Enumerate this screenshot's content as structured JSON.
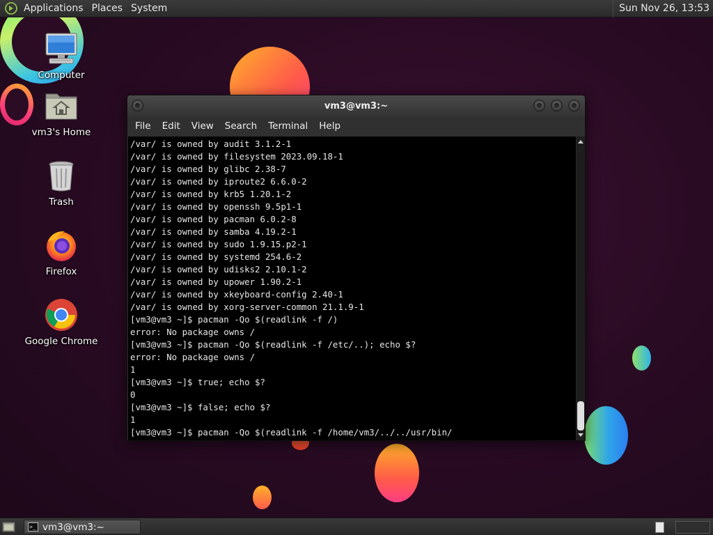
{
  "top_panel": {
    "menus": [
      "Applications",
      "Places",
      "System"
    ],
    "clock": "Sun Nov 26, 13:53"
  },
  "desktop": {
    "icons": [
      {
        "label": "Computer",
        "icon": "computer-icon"
      },
      {
        "label": "vm3's Home",
        "icon": "home-folder-icon"
      },
      {
        "label": "Trash",
        "icon": "trash-icon"
      },
      {
        "label": "Firefox",
        "icon": "firefox-icon"
      },
      {
        "label": "Google Chrome",
        "icon": "chrome-icon"
      }
    ]
  },
  "terminal": {
    "title": "vm3@vm3:~",
    "menus": [
      "File",
      "Edit",
      "View",
      "Search",
      "Terminal",
      "Help"
    ],
    "lines": [
      "/var/ is owned by audit 3.1.2-1",
      "/var/ is owned by filesystem 2023.09.18-1",
      "/var/ is owned by glibc 2.38-7",
      "/var/ is owned by iproute2 6.6.0-2",
      "/var/ is owned by krb5 1.20.1-2",
      "/var/ is owned by openssh 9.5p1-1",
      "/var/ is owned by pacman 6.0.2-8",
      "/var/ is owned by samba 4.19.2-1",
      "/var/ is owned by sudo 1.9.15.p2-1",
      "/var/ is owned by systemd 254.6-2",
      "/var/ is owned by udisks2 2.10.1-2",
      "/var/ is owned by upower 1.90.2-1",
      "/var/ is owned by xkeyboard-config 2.40-1",
      "/var/ is owned by xorg-server-common 21.1.9-1",
      "[vm3@vm3 ~]$ pacman -Qo $(readlink -f /)",
      "error: No package owns /",
      "[vm3@vm3 ~]$ pacman -Qo $(readlink -f /etc/..); echo $?",
      "error: No package owns /",
      "1",
      "[vm3@vm3 ~]$ true; echo $?",
      "0",
      "[vm3@vm3 ~]$ false; echo $?",
      "1",
      "[vm3@vm3 ~]$ pacman -Qo $(readlink -f /home/vm3/../../usr/bin/"
    ]
  },
  "bottom_panel": {
    "task_label": "vm3@vm3:~"
  },
  "colors": {
    "wallpaper": "#2a0b24",
    "panel": "#2f2f2f",
    "terminal_bg": "#000000",
    "terminal_fg": "#e6e6e6"
  }
}
